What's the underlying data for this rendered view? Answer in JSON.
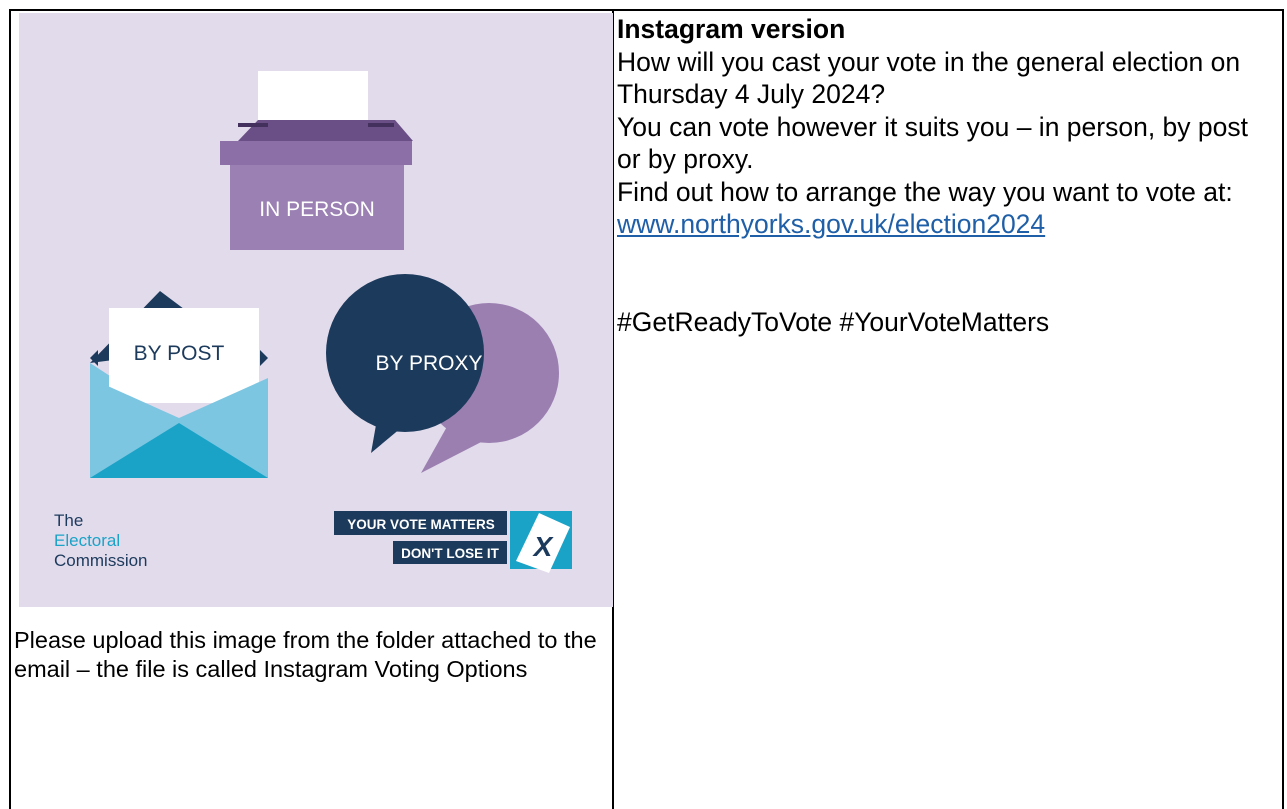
{
  "graphic": {
    "in_person_label": "IN PERSON",
    "by_post_label": "BY POST",
    "by_proxy_label": "BY PROXY",
    "ec_logo": [
      "The",
      "Electoral",
      "Commission"
    ],
    "yvm_line1": "YOUR VOTE MATTERS",
    "yvm_line2": "DON'T LOSE IT",
    "yvm_mark": "X"
  },
  "caption": "Please upload this image from the folder attached to the email – the file is called Instagram Voting Options",
  "right": {
    "heading": "Instagram version",
    "line1": "How will you cast your vote in the general election on Thursday 4 July 2024?",
    "line2": "You can vote however it suits you – in person, by post or by proxy.",
    "line3": "Find out how to arrange the way you want to vote at:",
    "link": "www.northyorks.gov.uk/election2024 ",
    "hashtags": "#GetReadyToVote #YourVoteMatters"
  },
  "colors": {
    "background": "#e2dbec",
    "purple": "#8c6fa6",
    "purple_dark": "#7a5d95",
    "navy": "#1c3a5c",
    "light_blue": "#7cc6e2",
    "teal": "#1aa3c7",
    "link": "#1f5fa8"
  }
}
